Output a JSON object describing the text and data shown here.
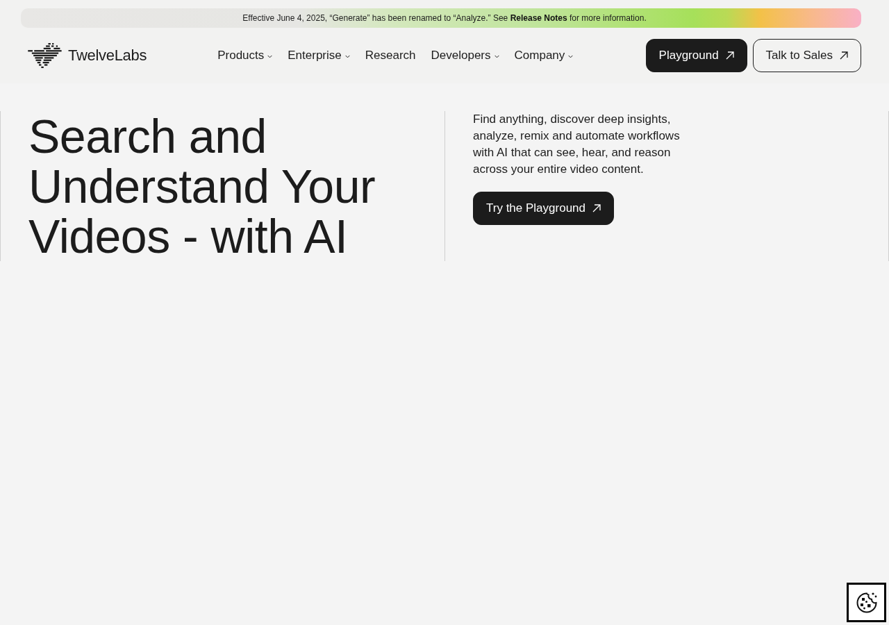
{
  "announcement": {
    "text_before": "Effective June 4, 2025, “Generate” has been renamed to “Analyze.” See",
    "link": "Release Notes",
    "text_after": "for more information."
  },
  "header": {
    "brand": "TwelveLabs",
    "nav": [
      {
        "label": "Products",
        "has_menu": true
      },
      {
        "label": "Enterprise",
        "has_menu": true
      },
      {
        "label": "Research",
        "has_menu": false
      },
      {
        "label": "Developers",
        "has_menu": true
      },
      {
        "label": "Company",
        "has_menu": true
      }
    ],
    "actions": [
      {
        "label": "Playground",
        "kind": "primary"
      },
      {
        "label": "Talk to Sales",
        "kind": "outline"
      }
    ]
  },
  "hero": {
    "title": "Search and Understand Your Videos - with AI",
    "description": "Find anything, discover deep insights, analyze, remix and automate workflows with AI that can see, hear, and reason across your entire video content.",
    "cta": {
      "label": "Try the Playground",
      "kind": "primary"
    }
  }
}
